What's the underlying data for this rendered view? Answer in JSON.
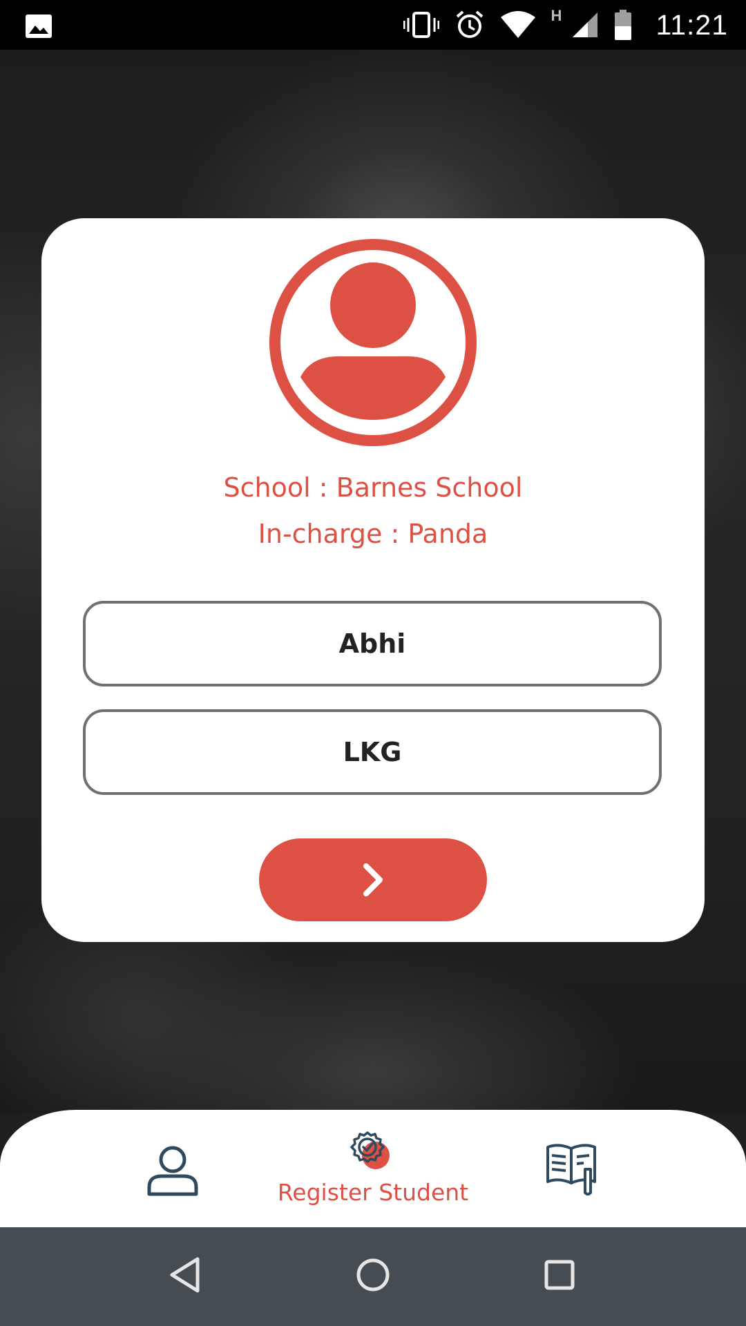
{
  "status_bar": {
    "time": "11:21",
    "network_type": "H",
    "icons": [
      "gallery-icon",
      "vibrate-icon",
      "alarm-icon",
      "wifi-icon",
      "signal-icon",
      "battery-icon"
    ]
  },
  "card": {
    "school_text": "School : Barnes School",
    "incharge_text": "In-charge : Panda",
    "student_name_value": "Abhi",
    "class_value": "LKG",
    "next_button_icon": "chevron-right-icon"
  },
  "bottom_nav": {
    "items": [
      {
        "icon": "user-icon",
        "label": ""
      },
      {
        "icon": "badge-icon",
        "label": "Register Student"
      },
      {
        "icon": "book-icon",
        "label": ""
      }
    ]
  },
  "system_nav": {
    "icons": [
      "back-icon",
      "home-icon",
      "recents-icon"
    ]
  },
  "colors": {
    "accent": "#dd5044",
    "nav_icon": "#2f4a5e",
    "system_bar": "#464d52"
  }
}
